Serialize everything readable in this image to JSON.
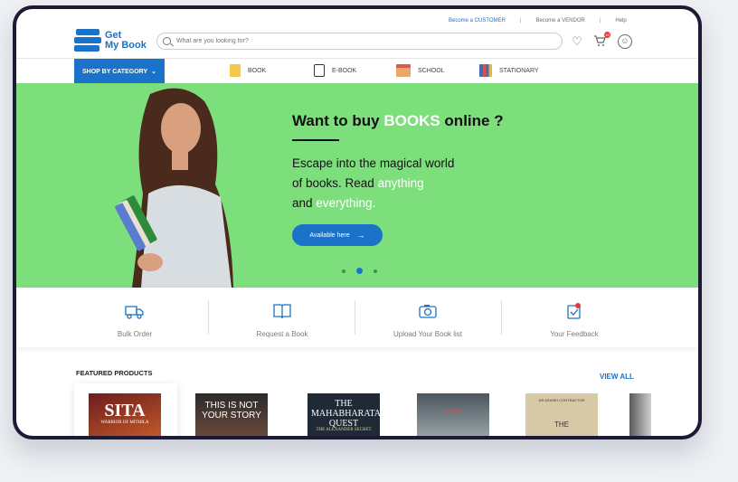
{
  "header": {
    "logo_line1": "Get",
    "logo_line2": "My Book",
    "links": [
      "Become a CUSTOMER",
      "Become a VENDOR",
      "Help"
    ],
    "separator": "|",
    "search_placeholder": "What are you looking for?",
    "cart_count": "10"
  },
  "nav": {
    "category_button": "SHOP BY CATEGORY",
    "items": [
      "BOOK",
      "E-BOOK",
      "SCHOOL",
      "STATIONARY"
    ]
  },
  "hero": {
    "title_pre": "Want to buy ",
    "title_highlight": "BOOKS",
    "title_post": " online ?",
    "sub_1": "Escape into the magical world",
    "sub_2": "of books. Read ",
    "sub_2_hl": "anything",
    "sub_3": "and ",
    "sub_3_hl": "everything.",
    "button": "Available here",
    "slide_count": 3,
    "active_slide": 2
  },
  "services": [
    "Bulk Order",
    "Request a Book",
    "Upload Your Book list",
    "Your Feedback"
  ],
  "featured": {
    "title": "FEATURED PRODUCTS",
    "view_all": "VIEW ALL",
    "books": [
      {
        "title": "SITA",
        "subtitle": "WARRIOR OF MITHILA"
      },
      {
        "title": "THIS IS NOT YOUR STORY",
        "subtitle": ""
      },
      {
        "title": "THE MAHABHARATA QUEST",
        "subtitle": "THE ALEXANDER SECRET"
      },
      {
        "title": "I AM",
        "subtitle": ""
      },
      {
        "title": "THE",
        "subtitle": "DR ASHISH CONTRACTOR"
      }
    ]
  },
  "colors": {
    "brand_blue": "#1a73c8",
    "hero_green": "#7ddf7c",
    "frame": "#1d1a36"
  }
}
